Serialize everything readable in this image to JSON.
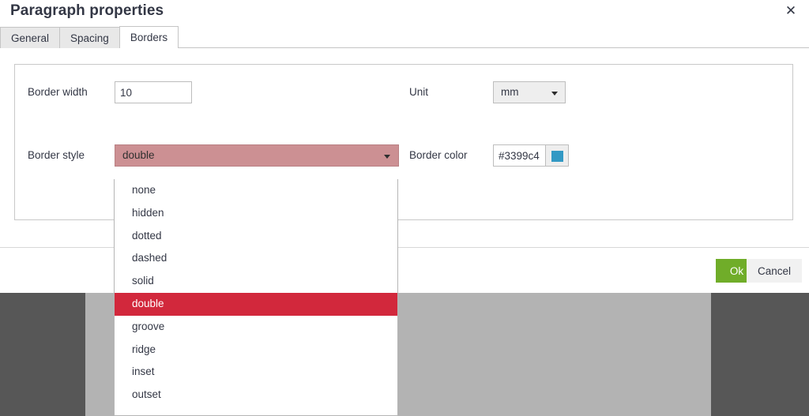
{
  "dialog": {
    "title": "Paragraph properties",
    "close_icon": "close-icon",
    "close_label": "✕"
  },
  "tabs": [
    {
      "label": "General",
      "active": false
    },
    {
      "label": "Spacing",
      "active": false
    },
    {
      "label": "Borders",
      "active": true
    }
  ],
  "form": {
    "border_width": {
      "label": "Border width",
      "value": "10",
      "placeholder": ""
    },
    "unit": {
      "label": "Unit",
      "value": "mm",
      "caret_icon": "chevron-down-icon",
      "options": [
        "mm"
      ]
    },
    "border_style": {
      "label": "Border style",
      "value": "double",
      "caret_icon": "chevron-down-icon",
      "options": [
        "none",
        "hidden",
        "dotted",
        "dashed",
        "solid",
        "double",
        "groove",
        "ridge",
        "inset",
        "outset"
      ],
      "selected_index": 5,
      "closed_field_bg": "#cc9093",
      "highlight_bg": "#d2283c",
      "highlight_fg": "#ffffff"
    },
    "border_color": {
      "label": "Border color",
      "value": "#3399c4",
      "placeholder": "",
      "swatch_color": "#3399c4",
      "swatch_icon": "color-swatch-icon"
    }
  },
  "footer": {
    "ok_label": "Ok",
    "ok_color": "#70ad29",
    "cancel_label": "Cancel",
    "cancel_color": "#f1f1f1"
  },
  "backdrop": {
    "dark_color": "#575757",
    "light_color": "#b3b3b3"
  }
}
